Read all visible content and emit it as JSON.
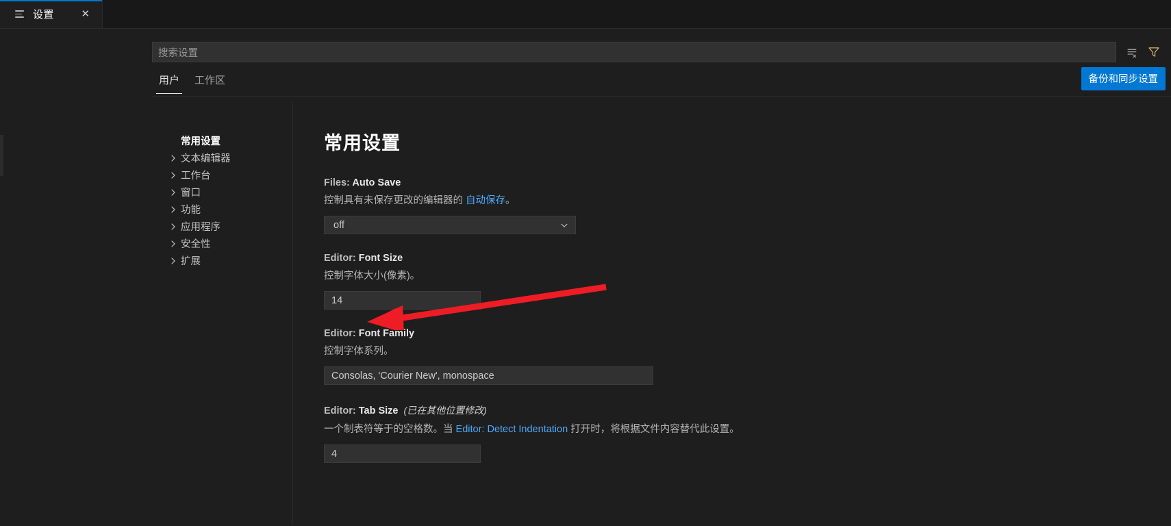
{
  "window": {
    "tab": {
      "title": "设置",
      "icon": "settings-lines-icon",
      "close_label": "✕"
    }
  },
  "search": {
    "placeholder": "搜索设置",
    "clear_icon": "clear-settings-search-icon",
    "filter_icon": "filter-funnel-icon"
  },
  "scope_tabs": [
    {
      "label": "用户",
      "active": true
    },
    {
      "label": "工作区",
      "active": false
    }
  ],
  "toolbar": {
    "sync_label": "备份和同步设置"
  },
  "toc": {
    "items": [
      {
        "label": "常用设置",
        "expandable": false,
        "selected": true
      },
      {
        "label": "文本编辑器",
        "expandable": true,
        "selected": false
      },
      {
        "label": "工作台",
        "expandable": true,
        "selected": false
      },
      {
        "label": "窗口",
        "expandable": true,
        "selected": false
      },
      {
        "label": "功能",
        "expandable": true,
        "selected": false
      },
      {
        "label": "应用程序",
        "expandable": true,
        "selected": false
      },
      {
        "label": "安全性",
        "expandable": true,
        "selected": false
      },
      {
        "label": "扩展",
        "expandable": true,
        "selected": false
      }
    ]
  },
  "main": {
    "title": "常用设置",
    "settings": [
      {
        "category": "Files: ",
        "name": "Auto Save",
        "modified_note": "",
        "desc_pre": "控制具有未保存更改的编辑器的 ",
        "desc_link": "自动保存",
        "desc_post": "。",
        "control": "select",
        "value": "off"
      },
      {
        "category": "Editor: ",
        "name": "Font Size",
        "modified_note": "",
        "desc_pre": "控制字体大小(像素)。",
        "desc_link": "",
        "desc_post": "",
        "control": "text-narrow",
        "value": "14"
      },
      {
        "category": "Editor: ",
        "name": "Font Family",
        "modified_note": "",
        "desc_pre": "控制字体系列。",
        "desc_link": "",
        "desc_post": "",
        "control": "text-wide",
        "value": "Consolas, 'Courier New', monospace"
      },
      {
        "category": "Editor: ",
        "name": "Tab Size",
        "modified_note": "(已在其他位置修改)",
        "desc_pre": "一个制表符等于的空格数。当 ",
        "desc_link": "Editor: Detect Indentation",
        "desc_post": " 打开时，将根据文件内容替代此设置。",
        "control": "text-narrow",
        "value": "4"
      }
    ]
  },
  "annotation": {
    "arrow_color": "#ee1c25",
    "points_to": "editor-font-size-input"
  },
  "colors": {
    "accent": "#0078d4",
    "link": "#4daafc",
    "background": "#1e1e1e",
    "tabbar": "#181818",
    "input": "#313131"
  }
}
